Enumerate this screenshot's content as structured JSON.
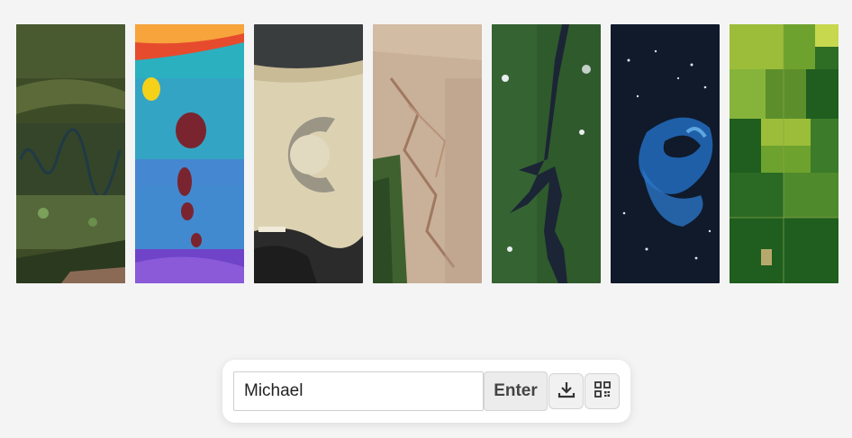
{
  "gallery": {
    "images": [
      {
        "name": "river-valley",
        "colors": [
          "#3b4a25",
          "#5e6b3a",
          "#2e3d22"
        ]
      },
      {
        "name": "salt-lakes",
        "colors": [
          "#1aa8c9",
          "#6d3fd0",
          "#7b2b2b"
        ]
      },
      {
        "name": "desert-arc-city",
        "colors": [
          "#d9cfae",
          "#8f8a78",
          "#2a2a2a"
        ]
      },
      {
        "name": "desert-dunes",
        "colors": [
          "#c7ad93",
          "#ad8f78",
          "#3d5a2e"
        ]
      },
      {
        "name": "forest-lake",
        "colors": [
          "#2f5a2c",
          "#1b2535",
          "#4b7a3a"
        ]
      },
      {
        "name": "ocean-bloom",
        "colors": [
          "#111b2c",
          "#1f5fa8",
          "#5fa7e0"
        ]
      },
      {
        "name": "farm-fields",
        "colors": [
          "#6ea22e",
          "#1f5e1e",
          "#c7d84e"
        ]
      }
    ]
  },
  "toolbar": {
    "name_value": "Michael",
    "enter_label": "Enter",
    "download_icon": "download-icon",
    "qr_icon": "qr-code-icon"
  }
}
